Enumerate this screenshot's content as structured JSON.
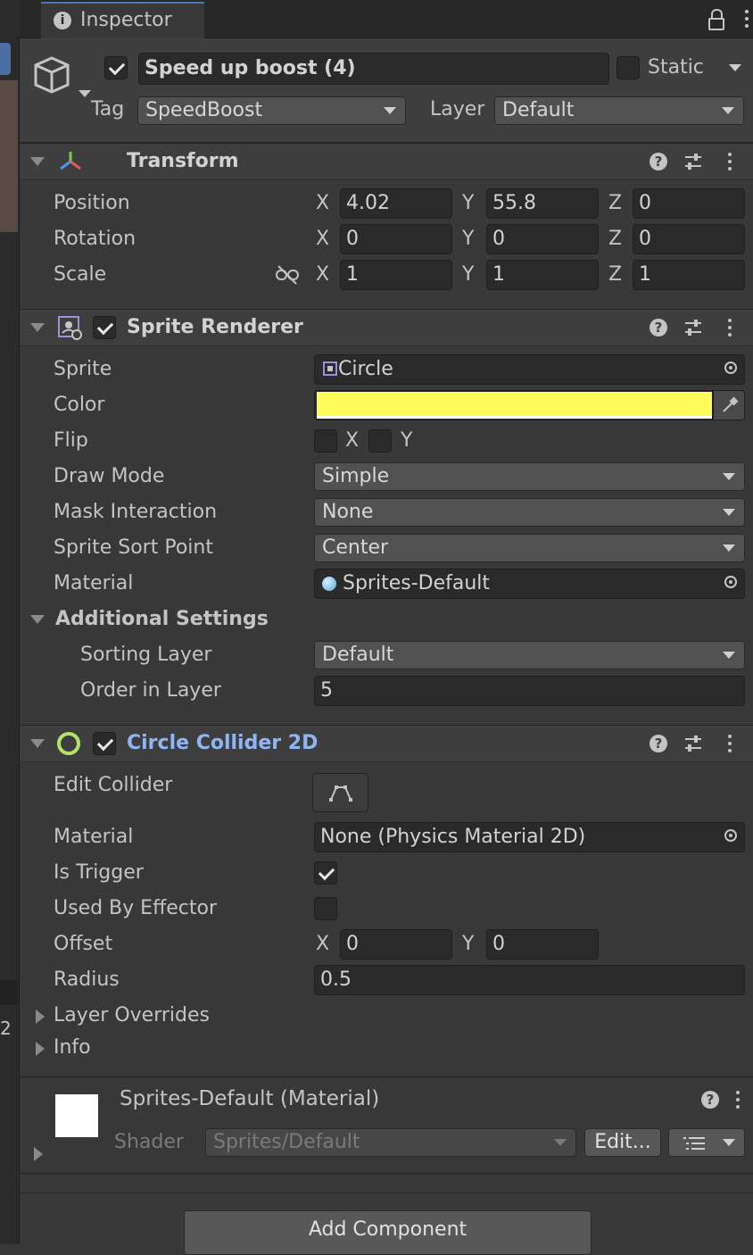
{
  "tab": {
    "title": "Inspector",
    "info_icon": "info-icon",
    "lock_icon": "lock-icon",
    "menu_icon": "kebab-menu-icon"
  },
  "edge": {
    "partial_number": "2"
  },
  "gameobject": {
    "active": true,
    "name": "Speed up boost (4)",
    "static_label": "Static",
    "static_checked": false,
    "tag_label": "Tag",
    "tag_value": "SpeedBoost",
    "layer_label": "Layer",
    "layer_value": "Default"
  },
  "transform": {
    "title": "Transform",
    "position_label": "Position",
    "rotation_label": "Rotation",
    "scale_label": "Scale",
    "axis_x": "X",
    "axis_y": "Y",
    "axis_z": "Z",
    "position": {
      "x": "4.02",
      "y": "55.8",
      "z": "0"
    },
    "rotation": {
      "x": "0",
      "y": "0",
      "z": "0"
    },
    "scale": {
      "x": "1",
      "y": "1",
      "z": "1"
    }
  },
  "sprite_renderer": {
    "title": "Sprite Renderer",
    "enabled": true,
    "sprite_label": "Sprite",
    "sprite_value": "Circle",
    "color_label": "Color",
    "color_value": "#fdfb5a",
    "flip_label": "Flip",
    "flip_x_label": "X",
    "flip_y_label": "Y",
    "draw_mode_label": "Draw Mode",
    "draw_mode_value": "Simple",
    "mask_label": "Mask Interaction",
    "mask_value": "None",
    "sort_point_label": "Sprite Sort Point",
    "sort_point_value": "Center",
    "material_label": "Material",
    "material_value": "Sprites-Default",
    "additional_label": "Additional Settings",
    "sorting_layer_label": "Sorting Layer",
    "sorting_layer_value": "Default",
    "order_label": "Order in Layer",
    "order_value": "5"
  },
  "circle_collider": {
    "title": "Circle Collider 2D",
    "enabled": true,
    "edit_label": "Edit Collider",
    "material_label": "Material",
    "material_value": "None (Physics Material 2D)",
    "trigger_label": "Is Trigger",
    "trigger_checked": true,
    "effector_label": "Used By Effector",
    "effector_checked": false,
    "offset_label": "Offset",
    "offset_x_label": "X",
    "offset_y_label": "Y",
    "offset": {
      "x": "0",
      "y": "0"
    },
    "radius_label": "Radius",
    "radius_value": "0.5",
    "layer_overrides_label": "Layer Overrides",
    "info_label": "Info"
  },
  "material_asset": {
    "title": "Sprites-Default (Material)",
    "shader_label": "Shader",
    "shader_value": "Sprites/Default",
    "edit_button": "Edit..."
  },
  "add_component_label": "Add Component",
  "colors": {
    "panel": "#383838",
    "header": "#3e3e3e",
    "accent_blue": "#8fb5f5",
    "collider_green": "#b4e36a",
    "swatch_yellow": "#fdfb5a"
  }
}
